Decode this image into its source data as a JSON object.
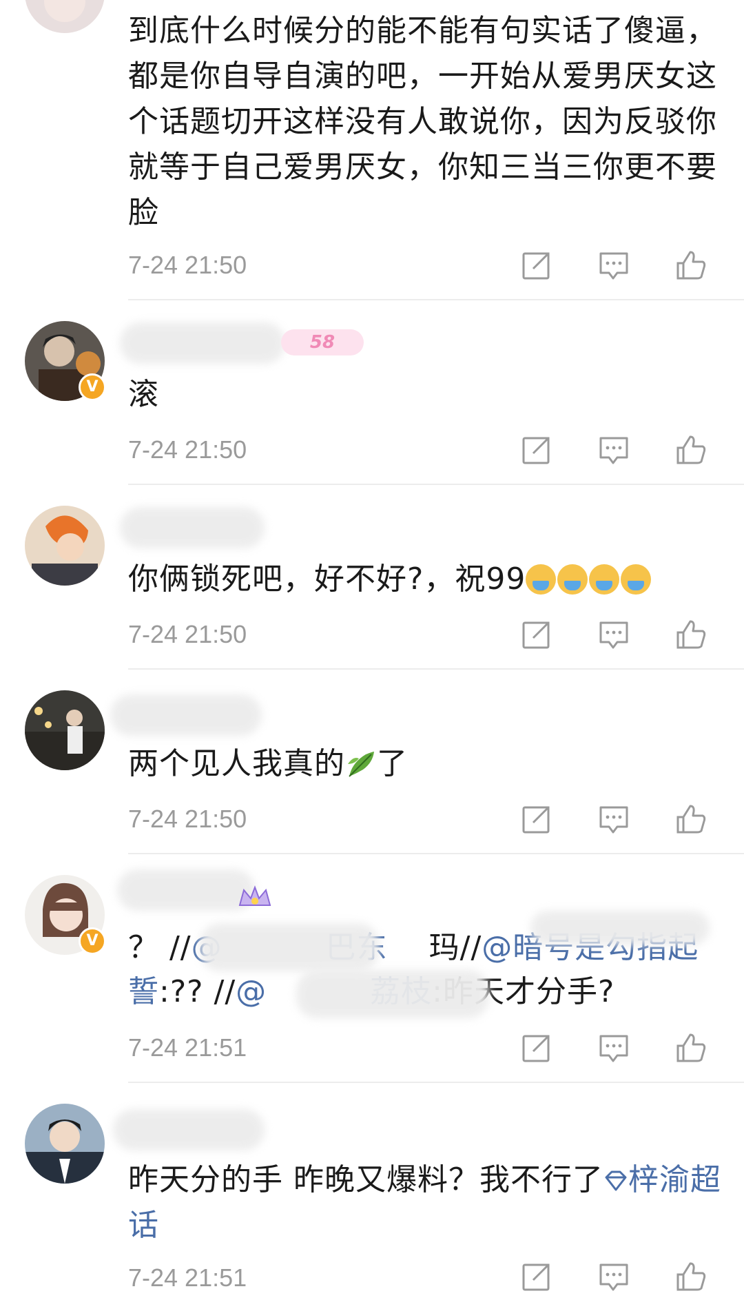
{
  "colors": {
    "link": "#4a6ea8",
    "time": "#9a9a9a",
    "verified": "#f5a623",
    "divider": "#ececec"
  },
  "comments": [
    {
      "id": "c1",
      "text": "到底什么时候分的能不能有句实话了傻逼，都是你自导自演的吧，一开始从爱男厌女这个话题切开这样没有人敢说你，因为反驳你就等于自己爱男厌女，你知三当三你更不要脸",
      "time": "7-24 21:50"
    },
    {
      "id": "c2",
      "verified": true,
      "name_badge": "58",
      "text": "滚",
      "time": "7-24 21:50"
    },
    {
      "id": "c3",
      "text": "你俩锁死吧，好不好?，祝99",
      "emoji": "crying-face-emoji",
      "emoji_count": 4,
      "time": "7-24 21:50"
    },
    {
      "id": "c4",
      "text_before": "两个见人我真的",
      "text_after": "了",
      "emoji": "herb-leaf-emoji",
      "time": "7-24 21:50"
    },
    {
      "id": "c5",
      "verified": true,
      "p1": "？ //",
      "m1": "@",
      "p2": "巴东",
      "p3": "玛//",
      "m2": "@暗号是勾指起誓",
      "p4": ":?? //",
      "m3": "@",
      "m4": "荔枝",
      "p5": ":昨天才分手?",
      "time": "7-24 21:51"
    },
    {
      "id": "c6",
      "text": "昨天分的手 昨晚又爆料？我不行了",
      "topic": "梓渝超话",
      "time": "7-24 21:51"
    }
  ],
  "icons": {
    "share": "share-icon",
    "comment": "comment-icon",
    "like": "like-icon"
  }
}
